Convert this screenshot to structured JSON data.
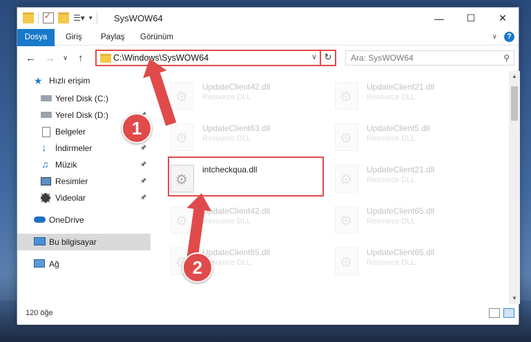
{
  "window": {
    "title": "SysWOW64"
  },
  "ribbon": {
    "tabs": [
      "Dosya",
      "Giriş",
      "Paylaş",
      "Görünüm"
    ]
  },
  "address": {
    "path": "C:\\Windows\\SysWOW64",
    "search_placeholder": "Ara: SysWOW64"
  },
  "sidebar": {
    "items": [
      {
        "label": "Hızlı erişim",
        "icon": "star-icon"
      },
      {
        "label": "Yerel Disk (C:)",
        "icon": "drive-icon"
      },
      {
        "label": "Yerel Disk (D:)",
        "icon": "drive-icon"
      },
      {
        "label": "Belgeler",
        "icon": "documents-icon"
      },
      {
        "label": "İndirmeler",
        "icon": "download-icon"
      },
      {
        "label": "Müzik",
        "icon": "music-icon"
      },
      {
        "label": "Resimler",
        "icon": "pictures-icon"
      },
      {
        "label": "Videolar",
        "icon": "video-icon"
      },
      {
        "label": "OneDrive",
        "icon": "cloud-icon"
      },
      {
        "label": "Bu bilgisayar",
        "icon": "computer-icon"
      },
      {
        "label": "Ağ",
        "icon": "network-icon"
      }
    ]
  },
  "files": [
    {
      "name": "UpdateClient42.dll",
      "type": "Resource DLL"
    },
    {
      "name": "UpdateClient21.dll",
      "type": "Resource DLL"
    },
    {
      "name": "UpdateClient63.dll",
      "type": "Resource DLL"
    },
    {
      "name": "UpdateClient5.dll",
      "type": "Resource DLL"
    },
    {
      "name": "intcheckqua.dll",
      "type": ""
    },
    {
      "name": "UpdateClient21.dll",
      "type": "Resource DLL"
    },
    {
      "name": "UpdateClient42.dll",
      "type": "Resource DLL"
    },
    {
      "name": "UpdateClient65.dll",
      "type": "Resource DLL"
    },
    {
      "name": "UpdateClient65.dll",
      "type": "Resource DLL"
    },
    {
      "name": "UpdateClient65.dll",
      "type": "Resource DLL"
    }
  ],
  "status": {
    "item_count": "120 öğe"
  },
  "annotations": {
    "badge1": "1",
    "badge2": "2"
  },
  "colors": {
    "accent": "#1979ca",
    "highlight": "#e04a4a"
  }
}
